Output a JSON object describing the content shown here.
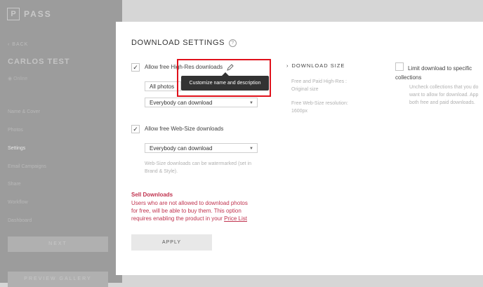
{
  "sidebar": {
    "logo_letter": "P",
    "logo_text": "PASS",
    "back_label": "BACK",
    "client_name": "CARLOS TEST",
    "status": "Online",
    "nav_items": [
      {
        "label": "Name & Cover"
      },
      {
        "label": "Photos"
      },
      {
        "label": "Settings"
      },
      {
        "label": "Email Campaigns"
      },
      {
        "label": "Share"
      },
      {
        "label": "Workflow"
      },
      {
        "label": "Dashboard"
      }
    ],
    "next_button": "NEXT",
    "bottom_button": "PREVIEW GALLERY"
  },
  "panel": {
    "title": "DOWNLOAD SETTINGS",
    "highres": {
      "label": "Allow free High-Res downloads",
      "checked": "✓",
      "photos_select": "All photos",
      "who_select": "Everybody can download"
    },
    "tooltip": "Customize name and description",
    "websize": {
      "label": "Allow free Web-Size downloads",
      "checked": "✓",
      "who_select": "Everybody can download",
      "hint_line1": "Web-Size downloads can be watermarked (set in",
      "hint_line2": "Brand & Style)."
    },
    "download_size": {
      "title": "DOWNLOAD SIZE",
      "line1": "Free and Paid High-Res :",
      "line2": "Original size",
      "line3": "Free Web-Size resolution:",
      "line4": "1600px"
    },
    "limit": {
      "label_line1": "Limit download to specific",
      "label_line2": "collections",
      "hint_line1": "Uncheck collections that you do",
      "hint_line2": "want to allow for download. App",
      "hint_line3": "both free and paid downloads."
    },
    "sell": {
      "title": "Sell Downloads",
      "text": "Users who are not allowed to download photos for free, will be able to buy them. This option requires enabling the product in your ",
      "link": "Price List"
    },
    "apply_label": "APPLY"
  }
}
